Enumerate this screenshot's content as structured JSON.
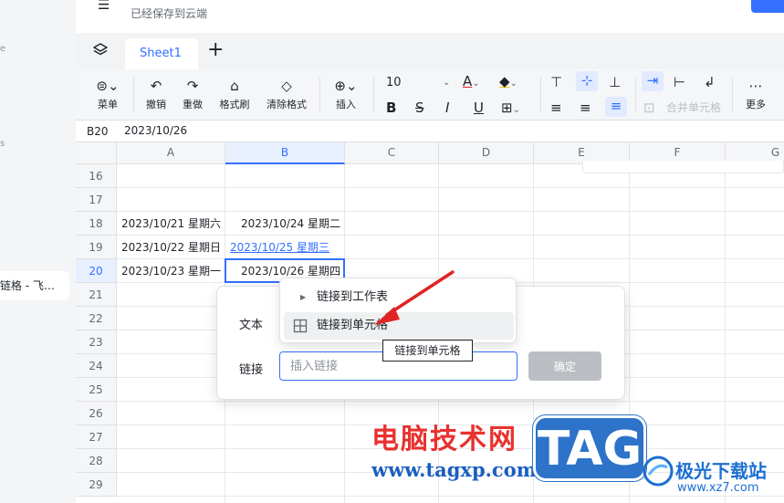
{
  "topbar": {
    "saved_status": "已经保存到云端"
  },
  "sidebar": {
    "doc_title": "链格 - 飞…",
    "glyph_1": "e",
    "glyph_2": "s"
  },
  "tabs": {
    "sheet": "Sheet1",
    "add": "+"
  },
  "toolbar": {
    "menu": "菜单",
    "undo": "撤销",
    "redo": "重做",
    "format_painter": "格式刷",
    "clear_format": "清除格式",
    "insert": "插入",
    "font_size": "10",
    "bold": "B",
    "strike": "S",
    "italic": "I",
    "underline": "U",
    "font_color": "A",
    "merge_cells": "合并单元格",
    "more": "更多"
  },
  "formula_bar": {
    "cell_ref": "B20",
    "value": "2023/10/26"
  },
  "grid": {
    "columns": [
      "A",
      "B",
      "C",
      "D",
      "E",
      "F",
      "G"
    ],
    "rows": [
      "16",
      "17",
      "18",
      "19",
      "20",
      "21",
      "22",
      "23",
      "24",
      "25",
      "26",
      "27",
      "28",
      "29"
    ],
    "active_column": "B",
    "active_row": "20",
    "cells": {
      "A18": "2023/10/21 星期六",
      "B18": "2023/10/24 星期二",
      "A19": "2023/10/22 星期日",
      "B19": "2023/10/25 星期三",
      "A20": "2023/10/23 星期一",
      "B20": "2023/10/26 星期四"
    }
  },
  "link_dialog": {
    "text_label": "文本",
    "link_label": "链接",
    "link_placeholder": "插入链接",
    "confirm": "确定"
  },
  "dropdown": {
    "items": [
      {
        "label": "链接到工作表"
      },
      {
        "label": "链接到单元格"
      }
    ],
    "tooltip": "链接到单元格"
  },
  "watermark": {
    "site_name": "电脑技术网",
    "site_url": "www.tagxp.com",
    "tag": "TAG",
    "brand": "极光下载站",
    "brand_url": "www.xz7.com"
  },
  "colors": {
    "accent": "#3370ff",
    "arrow": "#e02424",
    "watermark_red": "#e8322f",
    "watermark_blue": "#2d73c9"
  }
}
